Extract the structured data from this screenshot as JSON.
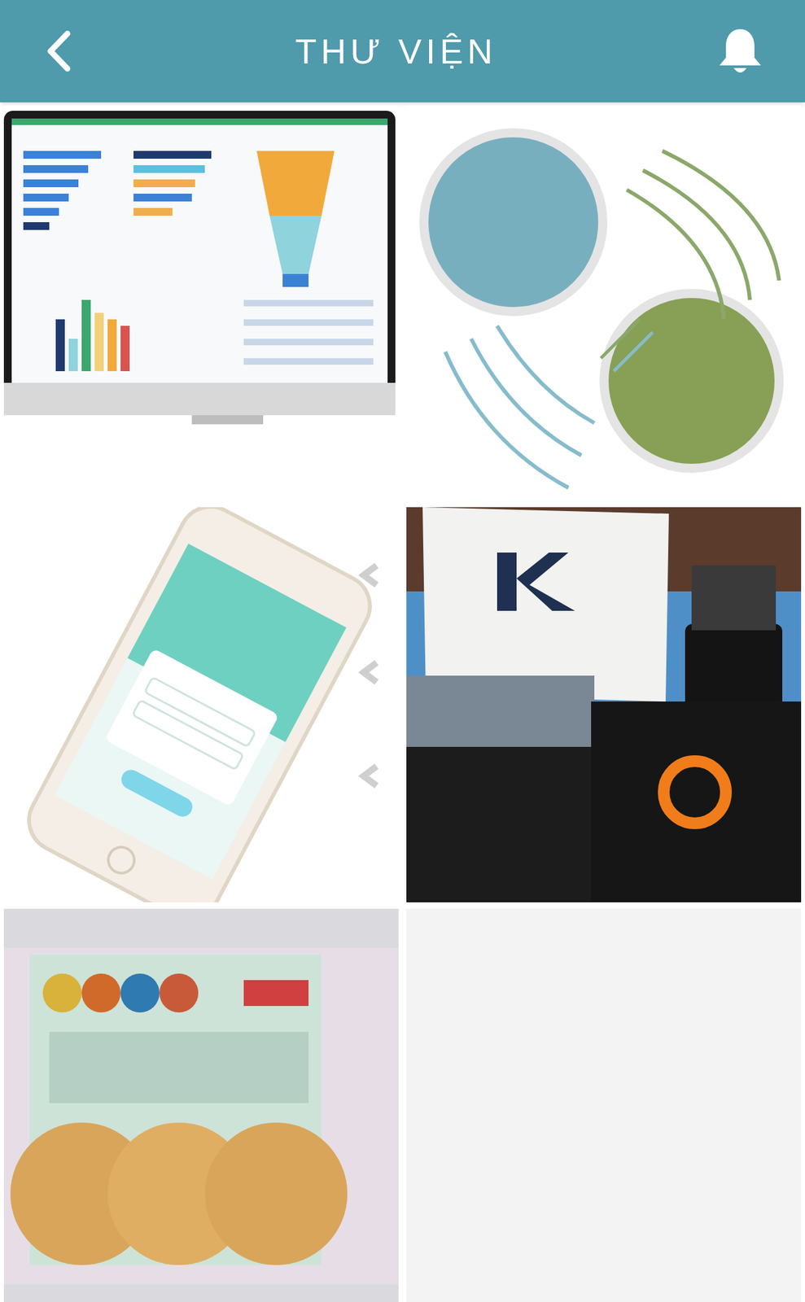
{
  "header": {
    "title": "THƯ VIỆN"
  },
  "images": [
    {
      "kind": "dashboard"
    },
    {
      "kind": "diagram"
    },
    {
      "kind": "phone"
    },
    {
      "kind": "photo"
    },
    {
      "kind": "product"
    }
  ]
}
